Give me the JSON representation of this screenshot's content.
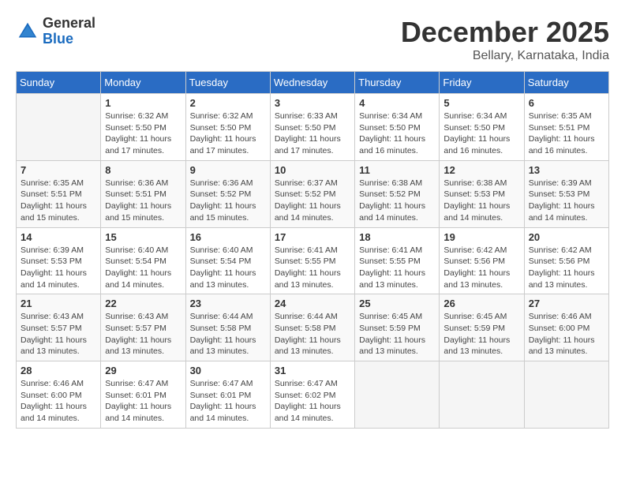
{
  "header": {
    "logo_general": "General",
    "logo_blue": "Blue",
    "month": "December 2025",
    "location": "Bellary, Karnataka, India"
  },
  "weekdays": [
    "Sunday",
    "Monday",
    "Tuesday",
    "Wednesday",
    "Thursday",
    "Friday",
    "Saturday"
  ],
  "weeks": [
    [
      {
        "day": "",
        "info": ""
      },
      {
        "day": "1",
        "info": "Sunrise: 6:32 AM\nSunset: 5:50 PM\nDaylight: 11 hours\nand 17 minutes."
      },
      {
        "day": "2",
        "info": "Sunrise: 6:32 AM\nSunset: 5:50 PM\nDaylight: 11 hours\nand 17 minutes."
      },
      {
        "day": "3",
        "info": "Sunrise: 6:33 AM\nSunset: 5:50 PM\nDaylight: 11 hours\nand 17 minutes."
      },
      {
        "day": "4",
        "info": "Sunrise: 6:34 AM\nSunset: 5:50 PM\nDaylight: 11 hours\nand 16 minutes."
      },
      {
        "day": "5",
        "info": "Sunrise: 6:34 AM\nSunset: 5:50 PM\nDaylight: 11 hours\nand 16 minutes."
      },
      {
        "day": "6",
        "info": "Sunrise: 6:35 AM\nSunset: 5:51 PM\nDaylight: 11 hours\nand 16 minutes."
      }
    ],
    [
      {
        "day": "7",
        "info": "Sunrise: 6:35 AM\nSunset: 5:51 PM\nDaylight: 11 hours\nand 15 minutes."
      },
      {
        "day": "8",
        "info": "Sunrise: 6:36 AM\nSunset: 5:51 PM\nDaylight: 11 hours\nand 15 minutes."
      },
      {
        "day": "9",
        "info": "Sunrise: 6:36 AM\nSunset: 5:52 PM\nDaylight: 11 hours\nand 15 minutes."
      },
      {
        "day": "10",
        "info": "Sunrise: 6:37 AM\nSunset: 5:52 PM\nDaylight: 11 hours\nand 14 minutes."
      },
      {
        "day": "11",
        "info": "Sunrise: 6:38 AM\nSunset: 5:52 PM\nDaylight: 11 hours\nand 14 minutes."
      },
      {
        "day": "12",
        "info": "Sunrise: 6:38 AM\nSunset: 5:53 PM\nDaylight: 11 hours\nand 14 minutes."
      },
      {
        "day": "13",
        "info": "Sunrise: 6:39 AM\nSunset: 5:53 PM\nDaylight: 11 hours\nand 14 minutes."
      }
    ],
    [
      {
        "day": "14",
        "info": "Sunrise: 6:39 AM\nSunset: 5:53 PM\nDaylight: 11 hours\nand 14 minutes."
      },
      {
        "day": "15",
        "info": "Sunrise: 6:40 AM\nSunset: 5:54 PM\nDaylight: 11 hours\nand 14 minutes."
      },
      {
        "day": "16",
        "info": "Sunrise: 6:40 AM\nSunset: 5:54 PM\nDaylight: 11 hours\nand 13 minutes."
      },
      {
        "day": "17",
        "info": "Sunrise: 6:41 AM\nSunset: 5:55 PM\nDaylight: 11 hours\nand 13 minutes."
      },
      {
        "day": "18",
        "info": "Sunrise: 6:41 AM\nSunset: 5:55 PM\nDaylight: 11 hours\nand 13 minutes."
      },
      {
        "day": "19",
        "info": "Sunrise: 6:42 AM\nSunset: 5:56 PM\nDaylight: 11 hours\nand 13 minutes."
      },
      {
        "day": "20",
        "info": "Sunrise: 6:42 AM\nSunset: 5:56 PM\nDaylight: 11 hours\nand 13 minutes."
      }
    ],
    [
      {
        "day": "21",
        "info": "Sunrise: 6:43 AM\nSunset: 5:57 PM\nDaylight: 11 hours\nand 13 minutes."
      },
      {
        "day": "22",
        "info": "Sunrise: 6:43 AM\nSunset: 5:57 PM\nDaylight: 11 hours\nand 13 minutes."
      },
      {
        "day": "23",
        "info": "Sunrise: 6:44 AM\nSunset: 5:58 PM\nDaylight: 11 hours\nand 13 minutes."
      },
      {
        "day": "24",
        "info": "Sunrise: 6:44 AM\nSunset: 5:58 PM\nDaylight: 11 hours\nand 13 minutes."
      },
      {
        "day": "25",
        "info": "Sunrise: 6:45 AM\nSunset: 5:59 PM\nDaylight: 11 hours\nand 13 minutes."
      },
      {
        "day": "26",
        "info": "Sunrise: 6:45 AM\nSunset: 5:59 PM\nDaylight: 11 hours\nand 13 minutes."
      },
      {
        "day": "27",
        "info": "Sunrise: 6:46 AM\nSunset: 6:00 PM\nDaylight: 11 hours\nand 13 minutes."
      }
    ],
    [
      {
        "day": "28",
        "info": "Sunrise: 6:46 AM\nSunset: 6:00 PM\nDaylight: 11 hours\nand 14 minutes."
      },
      {
        "day": "29",
        "info": "Sunrise: 6:47 AM\nSunset: 6:01 PM\nDaylight: 11 hours\nand 14 minutes."
      },
      {
        "day": "30",
        "info": "Sunrise: 6:47 AM\nSunset: 6:01 PM\nDaylight: 11 hours\nand 14 minutes."
      },
      {
        "day": "31",
        "info": "Sunrise: 6:47 AM\nSunset: 6:02 PM\nDaylight: 11 hours\nand 14 minutes."
      },
      {
        "day": "",
        "info": ""
      },
      {
        "day": "",
        "info": ""
      },
      {
        "day": "",
        "info": ""
      }
    ]
  ]
}
